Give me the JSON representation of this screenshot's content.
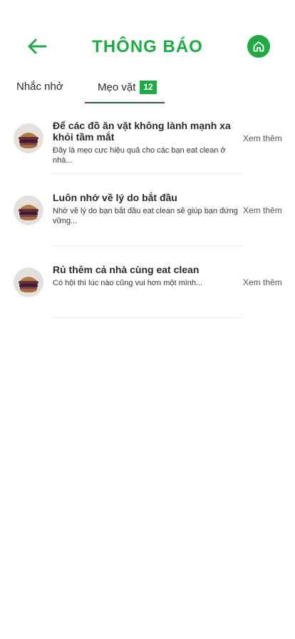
{
  "header": {
    "title": "THÔNG BÁO",
    "accent_color": "#1faa45",
    "back_icon": "arrow-left-icon",
    "home_icon": "home-icon"
  },
  "tabs": [
    {
      "label": "Nhắc nhở",
      "active": false
    },
    {
      "label": "Mẹo vặt",
      "active": true,
      "badge": "12"
    }
  ],
  "items": [
    {
      "title": "Để các đồ ăn vặt không lành mạnh xa khỏi tầm mắt",
      "description": "Đây là mẹo cực hiệu quả cho các bạn eat clean ở nhà...",
      "more": "Xem thêm",
      "thumbnail_icon": "burger-thumbnail"
    },
    {
      "title": "Luôn nhớ về lý do bắt đầu",
      "description": "Nhớ về lý do bạn bắt đầu eat clean sẽ giúp bạn đứng vững...",
      "more": "Xem thêm",
      "thumbnail_icon": "burger-thumbnail"
    },
    {
      "title": "Rủ thêm cả nhà cùng eat clean",
      "description": "Có hội thì lúc nào cũng vui hơn một mình...",
      "more": "Xem thêm",
      "thumbnail_icon": "burger-thumbnail"
    }
  ]
}
